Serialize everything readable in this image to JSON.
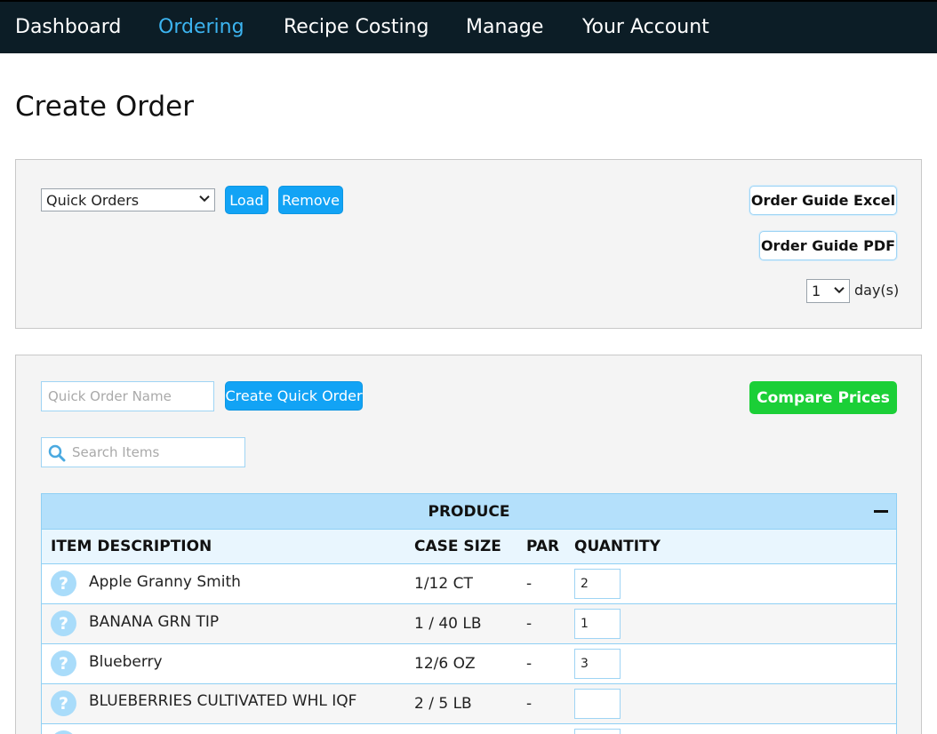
{
  "nav": {
    "items": [
      {
        "label": "Dashboard"
      },
      {
        "label": "Ordering"
      },
      {
        "label": "Recipe Costing"
      },
      {
        "label": "Manage"
      },
      {
        "label": "Your Account"
      }
    ],
    "active": "Ordering"
  },
  "page": {
    "title": "Create Order"
  },
  "top_panel": {
    "quick_orders_select": "Quick Orders",
    "load_label": "Load",
    "remove_label": "Remove",
    "excel_label": "Order Guide Excel",
    "pdf_label": "Order Guide PDF",
    "days_value": "1",
    "days_label": "day(s)"
  },
  "order_panel": {
    "quick_order_name_placeholder": "Quick Order Name",
    "create_quick_order_label": "Create Quick Order",
    "compare_prices_label": "Compare Prices",
    "search_placeholder": "Search Items"
  },
  "table": {
    "category": "PRODUCE",
    "headers": {
      "description": "ITEM DESCRIPTION",
      "case_size": "CASE SIZE",
      "par": "PAR",
      "quantity": "QUANTITY"
    },
    "rows": [
      {
        "description": "Apple Granny Smith",
        "case_size": "1/12 CT",
        "par": "-",
        "quantity": "2"
      },
      {
        "description": "BANANA GRN TIP",
        "case_size": "1 / 40 LB",
        "par": "-",
        "quantity": "1"
      },
      {
        "description": "Blueberry",
        "case_size": "12/6 OZ",
        "par": "-",
        "quantity": "3"
      },
      {
        "description": "BLUEBERRIES CULTIVATED WHL IQF",
        "case_size": "2 / 5 LB",
        "par": "-",
        "quantity": ""
      },
      {
        "description": "",
        "case_size": "",
        "par": "",
        "quantity": ""
      }
    ]
  },
  "colors": {
    "nav_bg": "#0c1d26",
    "nav_active": "#3cb4f0",
    "primary_button": "#12a3f5",
    "compare_button": "#1bcf37",
    "category_bg": "#b4e0fb",
    "header_bg": "#e9f6fe"
  },
  "icons": {
    "search": "search-icon",
    "help": "question-circle-icon",
    "collapse": "minus-icon",
    "dropdown": "chevron-down-icon"
  }
}
